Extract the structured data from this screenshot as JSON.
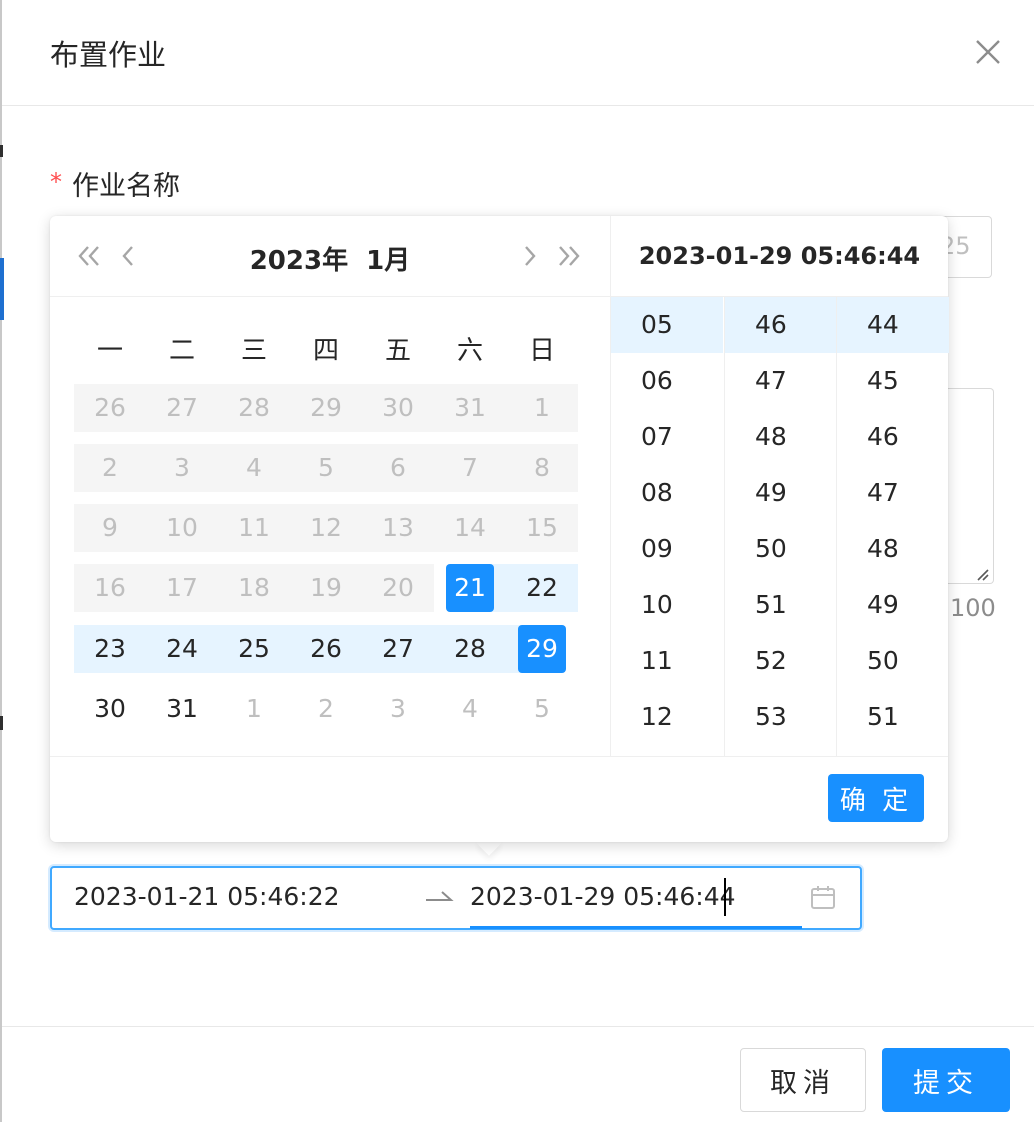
{
  "modal": {
    "title": "布置作业"
  },
  "form": {
    "required_mark": "*",
    "field_label": "作业名称",
    "name_count_fragment": "25",
    "textarea_count_fragment": "100"
  },
  "calendar": {
    "year_month": "2023年  1月",
    "weekdays": [
      "一",
      "二",
      "三",
      "四",
      "五",
      "六",
      "日"
    ],
    "weeks": [
      [
        "26",
        "27",
        "28",
        "29",
        "30",
        "31",
        "1"
      ],
      [
        "2",
        "3",
        "4",
        "5",
        "6",
        "7",
        "8"
      ],
      [
        "9",
        "10",
        "11",
        "12",
        "13",
        "14",
        "15"
      ],
      [
        "16",
        "17",
        "18",
        "19",
        "20",
        "21",
        "22"
      ],
      [
        "23",
        "24",
        "25",
        "26",
        "27",
        "28",
        "29"
      ],
      [
        "30",
        "31",
        "1",
        "2",
        "3",
        "4",
        "5"
      ]
    ],
    "range_start_day": "21",
    "range_end_day": "29",
    "selected_datetime": "2023-01-29 05:46:44",
    "hours": [
      "05",
      "06",
      "07",
      "08",
      "09",
      "10",
      "11",
      "12"
    ],
    "minutes": [
      "46",
      "47",
      "48",
      "49",
      "50",
      "51",
      "52",
      "53"
    ],
    "seconds": [
      "44",
      "45",
      "46",
      "47",
      "48",
      "49",
      "50",
      "51"
    ],
    "ok_label": "确 定"
  },
  "range_input": {
    "start": "2023-01-21 05:46:22",
    "end": "2023-01-29 05:46:44"
  },
  "footer": {
    "cancel_label": "取消",
    "submit_label": "提交"
  },
  "colors": {
    "primary": "#1890ff",
    "range_bg": "#e6f4ff",
    "disabled_bg": "#f5f5f5",
    "required": "#ff4d4f"
  }
}
